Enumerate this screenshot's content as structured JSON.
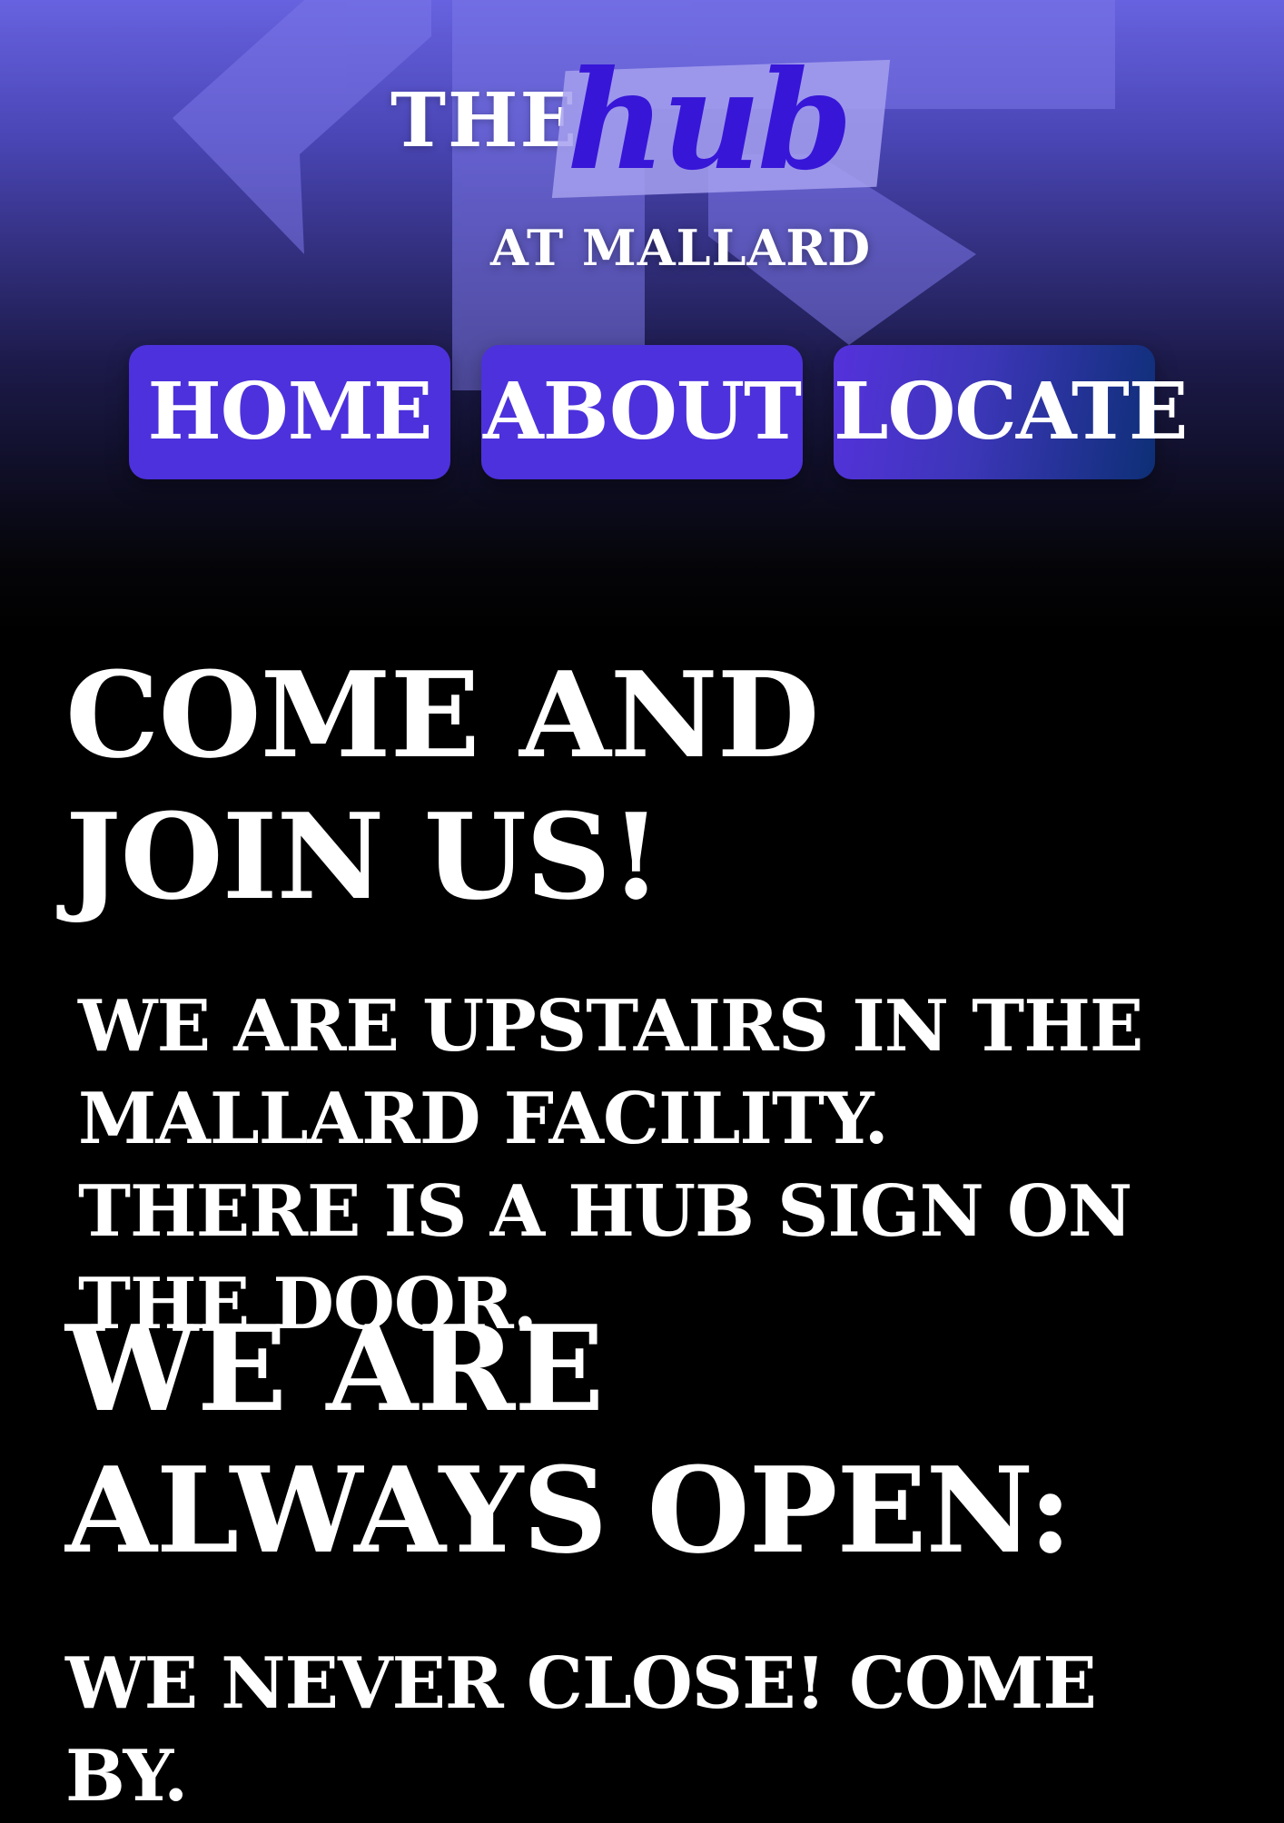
{
  "header": {
    "brand": {
      "the": "THE",
      "hub": "hub",
      "subtitle": "AT MALLARD"
    },
    "nav": [
      {
        "label": "HOME"
      },
      {
        "label": "ABOUT"
      },
      {
        "label": "LOCATE"
      }
    ]
  },
  "main": {
    "section1": {
      "title": "Come and join us!",
      "text": "We are upstairs in the Mallard facility. There is a hub sign on the door."
    },
    "section2": {
      "title": "We are always open:",
      "text": "We never close! Come by."
    }
  },
  "colors": {
    "header_top": "#6762df",
    "button": "#4d31dc",
    "hub_text": "#3716d8",
    "background": "#000000"
  }
}
